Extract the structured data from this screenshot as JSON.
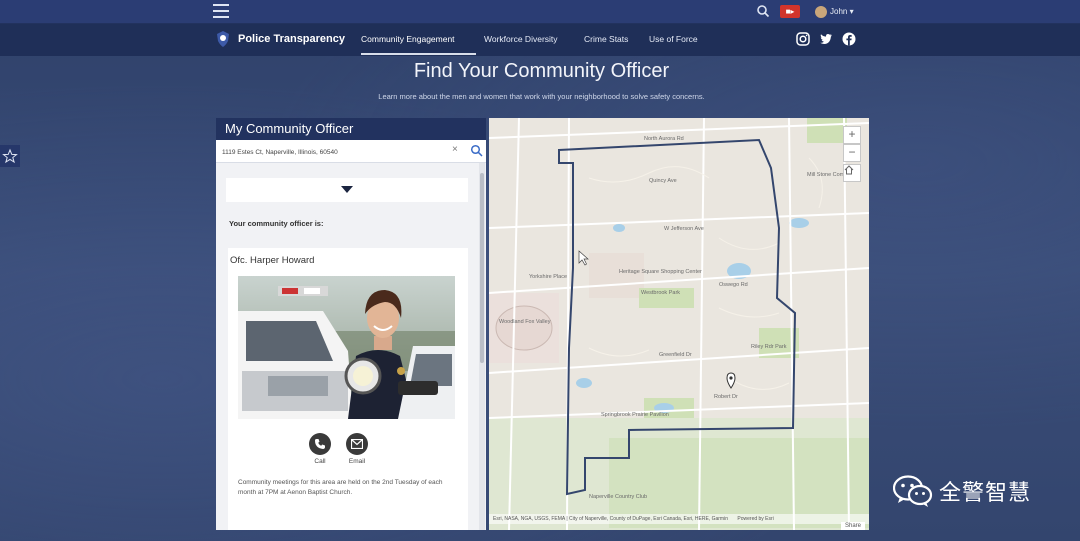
{
  "topbar": {
    "user_label": "John ▾",
    "icons": {
      "menu": "hamburger-icon",
      "search": "search-icon",
      "notification": "notification-icon"
    }
  },
  "nav": {
    "brand": "Police Transparency",
    "items": [
      "Community Engagement",
      "Workforce Diversity",
      "Crime Stats",
      "Use of Force"
    ],
    "active_index": 0,
    "social": [
      "instagram-icon",
      "twitter-icon",
      "facebook-icon"
    ]
  },
  "hero": {
    "title": "Find Your Community Officer",
    "subtitle": "Learn more about the men and women that work with your neighborhood to solve safety concerns."
  },
  "panel": {
    "header": "My Community Officer",
    "address_value": "1119 Estes Ct, Naperville, Illinois, 60540",
    "intro": "Your community officer is:",
    "officer_name": "Ofc. Harper Howard",
    "call_label": "Call",
    "email_label": "Email",
    "meeting_text": "Community meetings for this area are held on the 2nd Tuesday of each month at 7PM at Aenon Baptist Church."
  },
  "map": {
    "labels": [
      "North Aurora Rd",
      "Quincy Ave",
      "W Jefferson Ave",
      "Heritage Square Shopping Center",
      "Yorkshire Place",
      "Westbrook Park",
      "Mill Stone Commons",
      "Woodland Fox Valley",
      "Naperville Country Club",
      "Oswego Rd",
      "Springbrook Prairie Pavilion",
      "Riley Rdr Park",
      "Robert Dr",
      "Greenfield Dr"
    ],
    "attribution": "Esri, NASA, NGA, USGS, FEMA | City of Naperville, County of DuPage, Esri Canada, Esri, HERE, Garmin",
    "powered": "Powered by Esri",
    "share_label": "Share",
    "zoom_in": "+",
    "zoom_out": "−"
  },
  "watermark": {
    "text": "全警智慧"
  },
  "colors": {
    "topbar": "#2b3d74",
    "navbar": "#1f2f58",
    "panel_header": "#22325f",
    "boundary": "#34466d",
    "badge": "#d1342b"
  }
}
